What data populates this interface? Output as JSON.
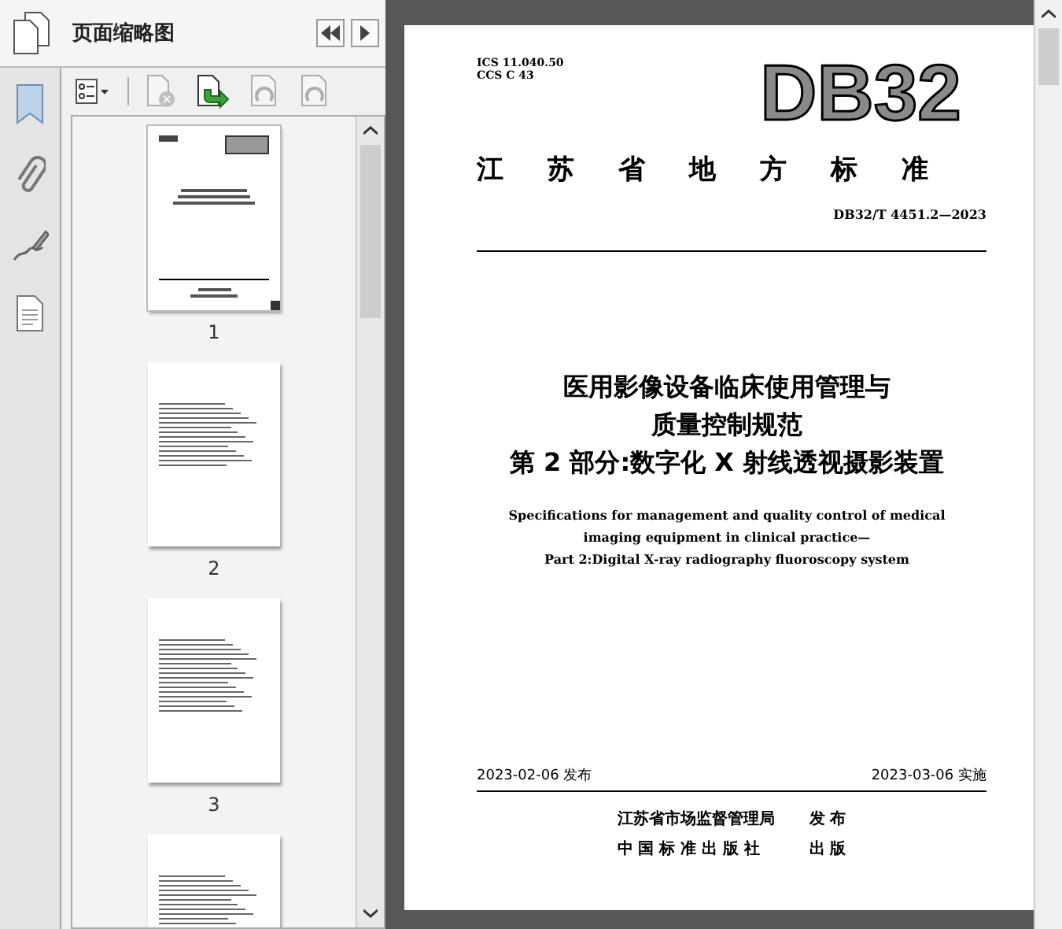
{
  "panel": {
    "title": "页面缩略图"
  },
  "toolbar": [
    {
      "kind": "options",
      "disabled": false
    },
    {
      "kind": "delete",
      "disabled": true
    },
    {
      "kind": "extract",
      "disabled": false
    },
    {
      "kind": "rotate-left",
      "disabled": true
    },
    {
      "kind": "rotate-right",
      "disabled": true
    }
  ],
  "thumbnails": [
    {
      "label": "1",
      "kind": "cover",
      "selected": true
    },
    {
      "label": "2",
      "kind": "toc",
      "selected": false
    },
    {
      "label": "3",
      "kind": "text",
      "selected": false
    },
    {
      "kind": "text",
      "selected": false
    }
  ],
  "document": {
    "ics": "ICS 11.040.50",
    "ccs": "CCS C 43",
    "logo": "DB32",
    "authority": "江苏省地方标准",
    "code": "DB32/T 4451.2—2023",
    "title_lines": [
      "医用影像设备临床使用管理与",
      "质量控制规范",
      "第 2 部分:数字化 X 射线透视摄影装置"
    ],
    "english_lines": [
      "Specifications for management and quality control of medical",
      "imaging equipment in clinical practice—",
      "Part 2:Digital X-ray radiography fluoroscopy system"
    ],
    "issue_date": "2023-02-06 发布",
    "effective_date": "2023-03-06 实施",
    "publishers": [
      {
        "name": "江苏省市场监督管理局",
        "role": "发 布"
      },
      {
        "name": "中 国 标 准 出 版 社",
        "role": "出 版"
      }
    ]
  }
}
